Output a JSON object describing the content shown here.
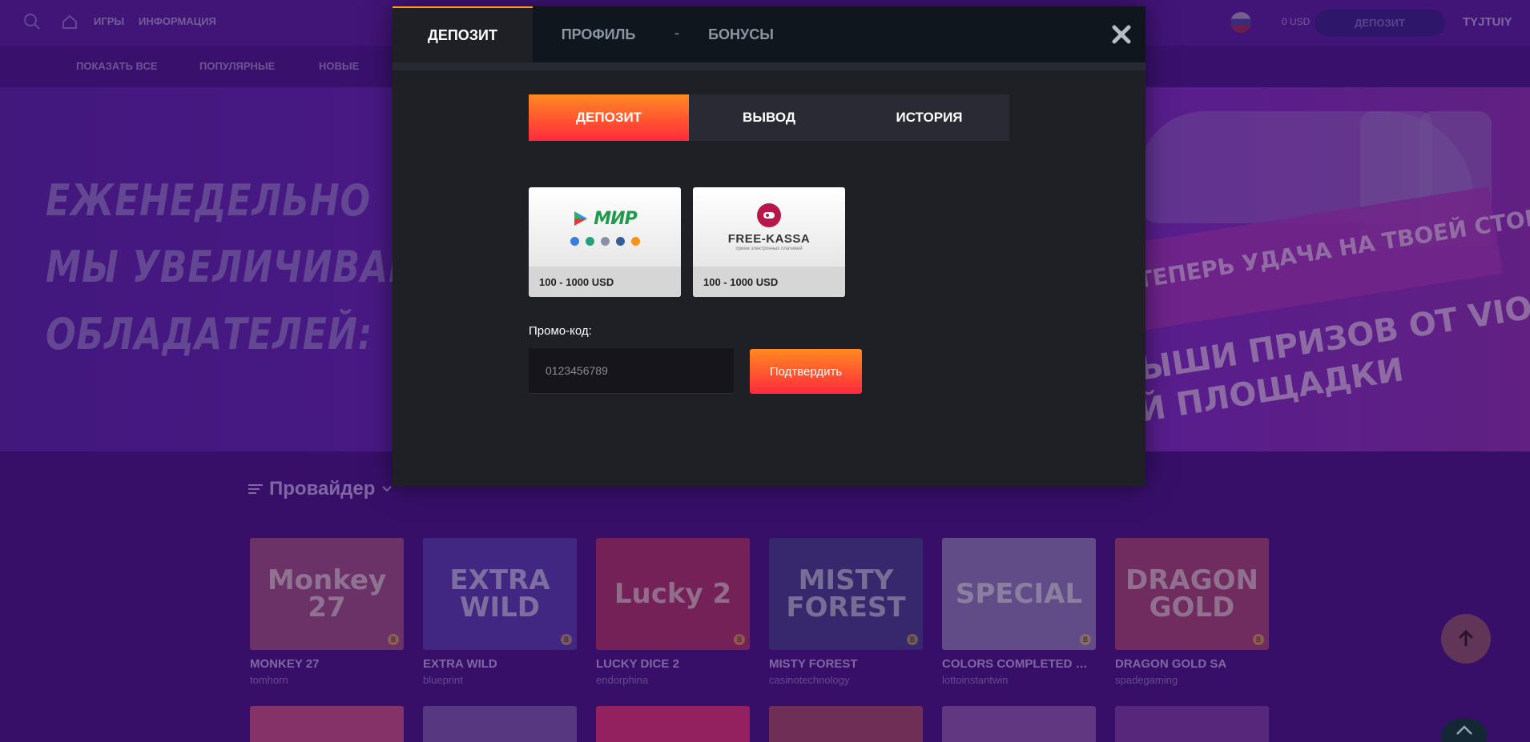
{
  "header": {
    "nav": [
      "ИГРЫ",
      "ИНФОРМАЦИЯ"
    ],
    "balance": "0 USD",
    "deposit_button": "ДЕПОЗИТ",
    "username": "TYJTUIY"
  },
  "categories": [
    "ПОКАЗАТЬ ВСЕ",
    "ПОПУЛЯРНЫЕ",
    "НОВЫЕ"
  ],
  "banner": {
    "lines": [
      "ЕЖЕНЕДЕЛЬНО",
      "МЫ УВЕЛИЧИВАЕМ",
      "ОБЛАДАТЕЛЕЙ:"
    ],
    "ribbon_text": "ТЕПЕРЬ УДАЧА НА ТВОЕЙ СТОРОНЕ",
    "right_lines": [
      "ЫШИ ПРИЗОВ ОТ VIOLET",
      "Й ПЛОЩАДКИ"
    ]
  },
  "provider_label": "Провайдер",
  "games": [
    {
      "name": "MONKEY 27",
      "provider": "tomhorn",
      "art": "Monkey 27",
      "color": "#9a4a86"
    },
    {
      "name": "EXTRA WILD",
      "provider": "blueprint",
      "art": "EXTRA WILD",
      "color": "#5a3ab0"
    },
    {
      "name": "LUCKY DICE 2",
      "provider": "endorphina",
      "art": "Lucky 2",
      "color": "#a8306e"
    },
    {
      "name": "MISTY FOREST",
      "provider": "casinotechnology",
      "art": "MISTY FOREST",
      "color": "#4a3a8e"
    },
    {
      "name": "COLORS COMPLETED WIN ...",
      "provider": "lottoinstantwin",
      "art": "SPECIAL",
      "color": "#8a72b8"
    },
    {
      "name": "DRAGON GOLD SA",
      "provider": "spadegaming",
      "art": "DRAGON GOLD",
      "color": "#a2407a"
    }
  ],
  "modal": {
    "tabs": [
      "ДЕПОЗИТ",
      "ПРОФИЛЬ",
      "БОНУСЫ"
    ],
    "separator": "-",
    "segments": [
      "ДЕПОЗИТ",
      "ВЫВОД",
      "ИСТОРИЯ"
    ],
    "methods": [
      {
        "brand": "МИР",
        "range": "100 - 1000 USD"
      },
      {
        "brand": "FREE-KASSA",
        "subtitle": "прием электронных платежей",
        "range": "100 - 1000 USD"
      }
    ],
    "promo_label": "Промо-код:",
    "promo_placeholder": "0123456789",
    "confirm_label": "Подтвердить"
  }
}
